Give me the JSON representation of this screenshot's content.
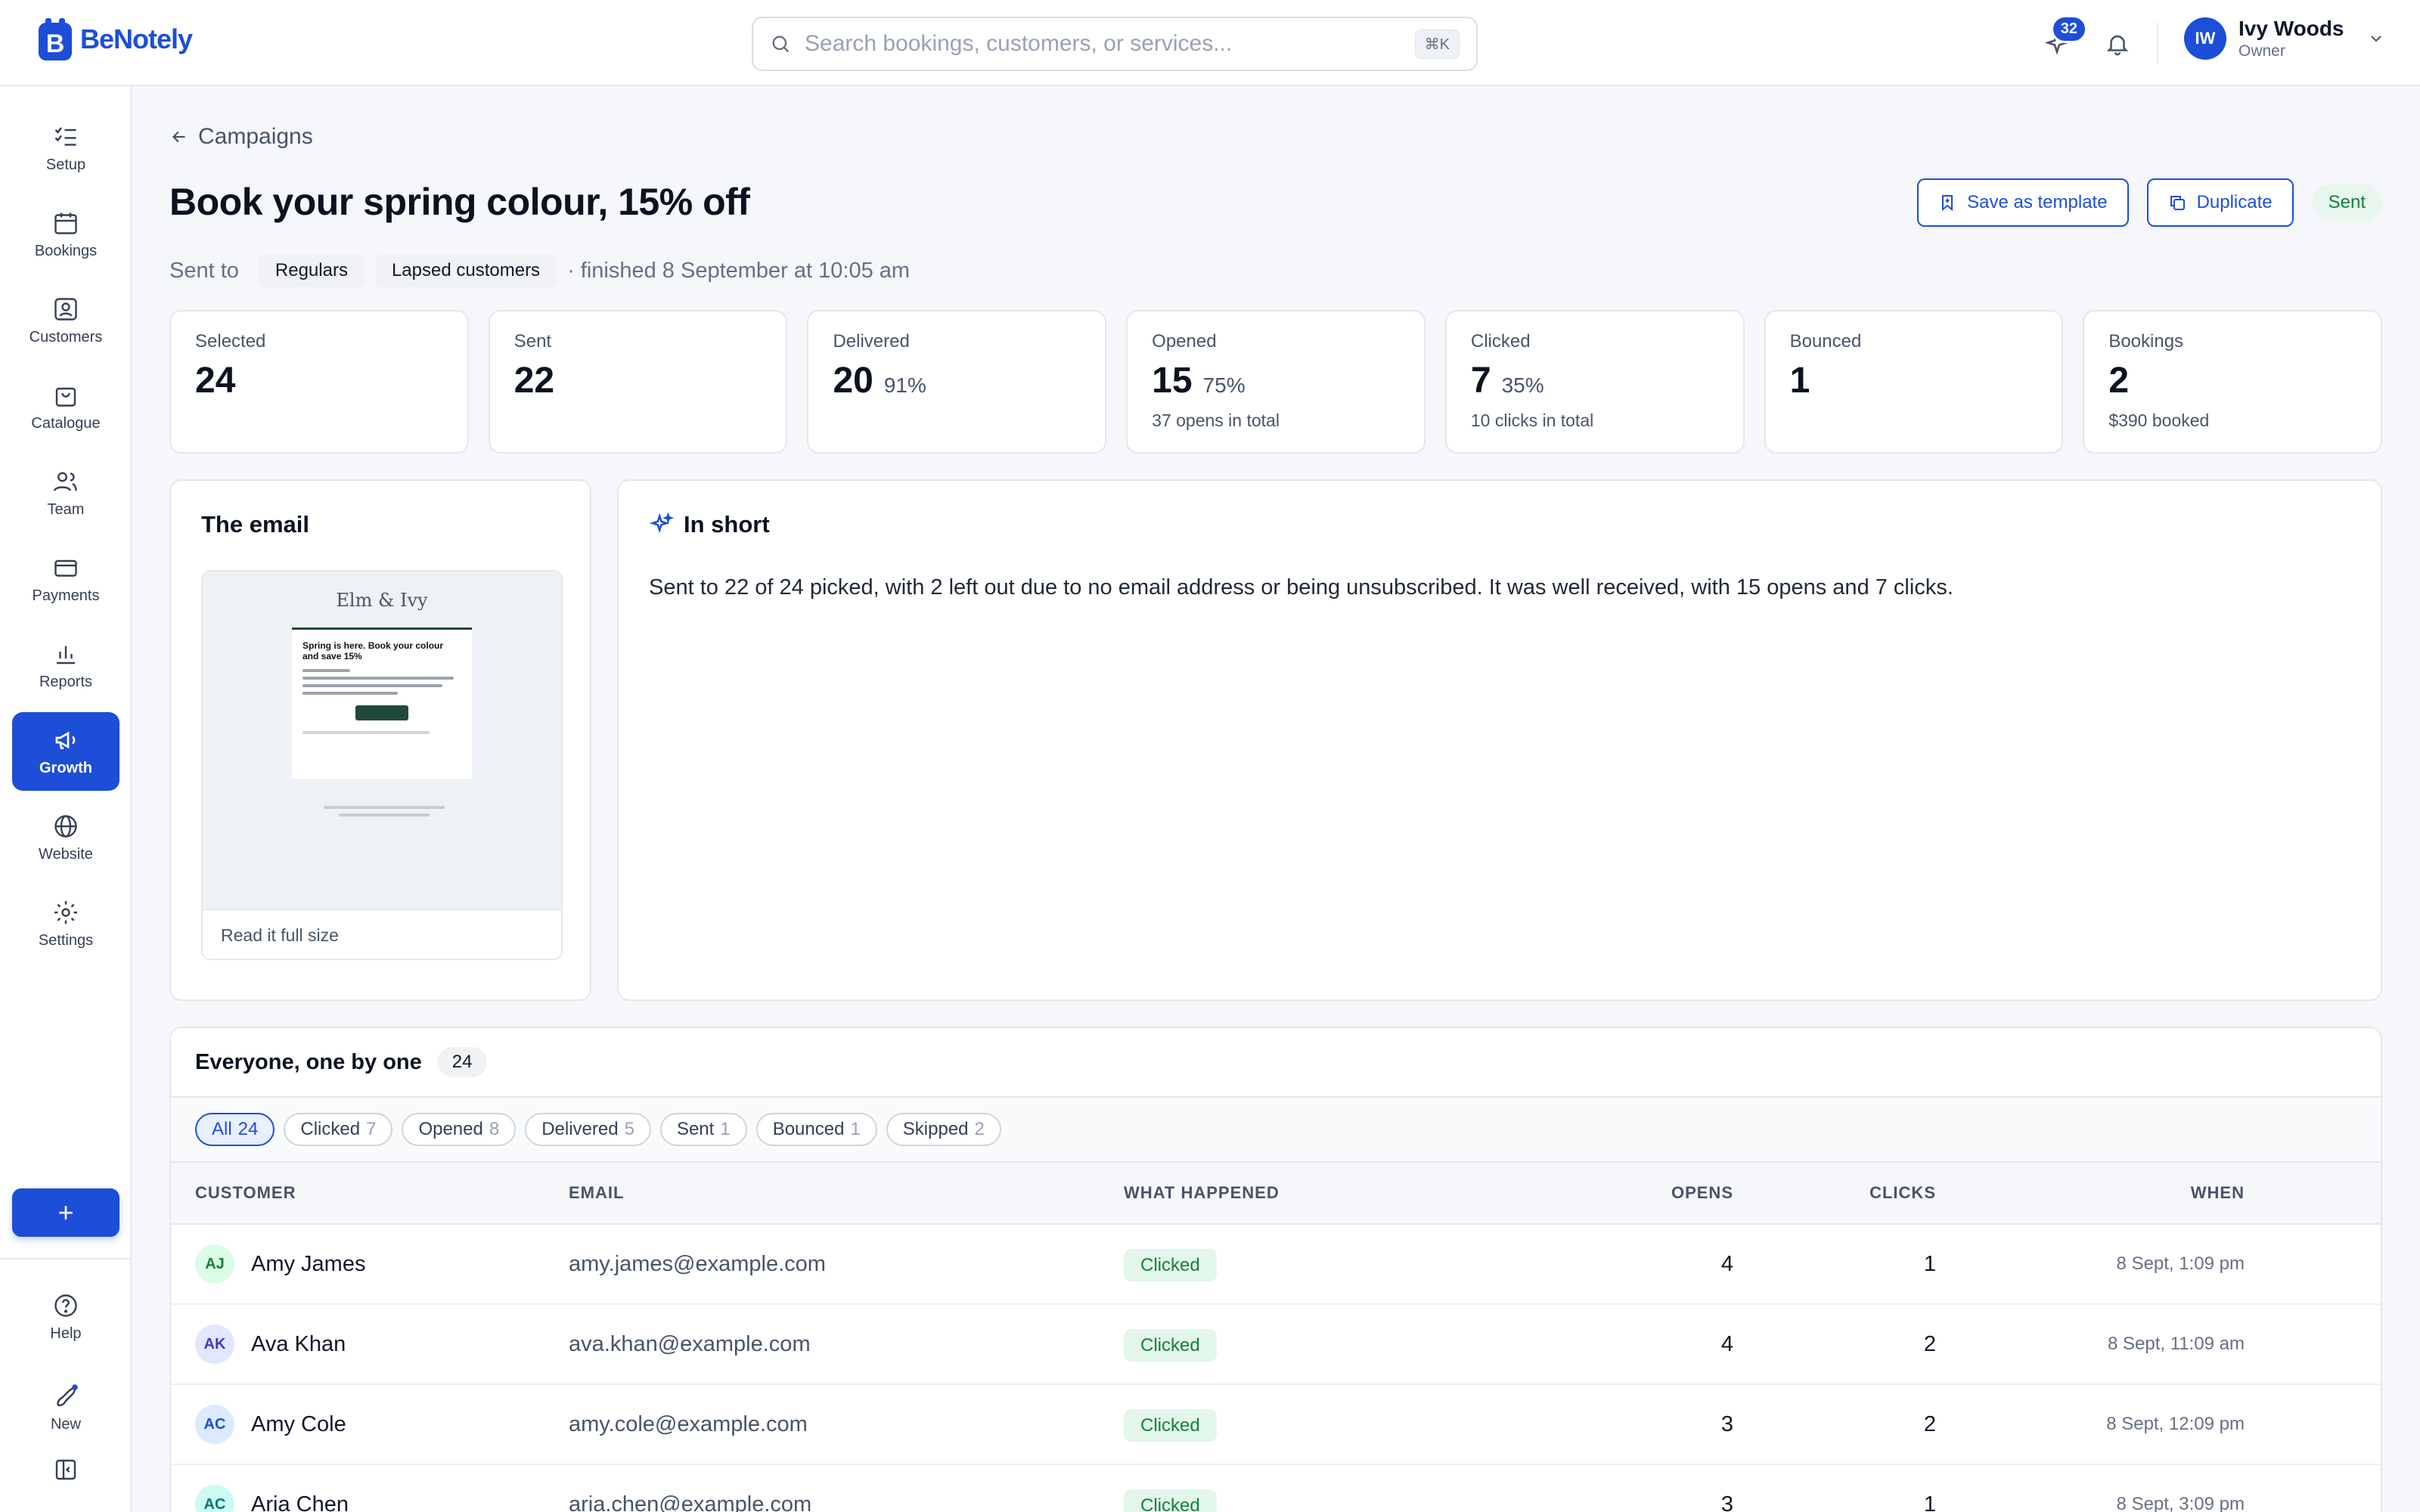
{
  "app": {
    "name": "BeNotely",
    "brand_color": "#1d4ed8"
  },
  "search": {
    "placeholder": "Search bookings, customers, or services...",
    "shortcut": "⌘K"
  },
  "header": {
    "notifications_count": "32"
  },
  "user": {
    "initials": "IW",
    "name": "Ivy Woods",
    "role": "Owner"
  },
  "sidebar": {
    "items": [
      {
        "label": "Setup",
        "icon": "checklist-icon"
      },
      {
        "label": "Bookings",
        "icon": "calendar-icon"
      },
      {
        "label": "Customers",
        "icon": "contact-icon"
      },
      {
        "label": "Catalogue",
        "icon": "bag-icon"
      },
      {
        "label": "Team",
        "icon": "people-icon"
      },
      {
        "label": "Payments",
        "icon": "card-icon"
      },
      {
        "label": "Reports",
        "icon": "chart-icon"
      },
      {
        "label": "Growth",
        "icon": "megaphone-icon",
        "active": true
      },
      {
        "label": "Website",
        "icon": "globe-icon"
      },
      {
        "label": "Settings",
        "icon": "gear-icon"
      }
    ],
    "new_button": "+",
    "help": "Help",
    "new": "New"
  },
  "page": {
    "back": "Campaigns",
    "title": "Book your spring colour, 15% off",
    "save_template": "Save as template",
    "duplicate": "Duplicate",
    "status": "Sent",
    "sent_to_label": "Sent to",
    "audiences": [
      "Regulars",
      "Lapsed customers"
    ],
    "finished": "· finished 8 September at 10:05 am"
  },
  "stats": [
    {
      "label": "Selected",
      "value": "24",
      "pct": "",
      "sub": ""
    },
    {
      "label": "Sent",
      "value": "22",
      "pct": "",
      "sub": ""
    },
    {
      "label": "Delivered",
      "value": "20",
      "pct": "91%",
      "sub": ""
    },
    {
      "label": "Opened",
      "value": "15",
      "pct": "75%",
      "sub": "37 opens in total"
    },
    {
      "label": "Clicked",
      "value": "7",
      "pct": "35%",
      "sub": "10 clicks in total"
    },
    {
      "label": "Bounced",
      "value": "1",
      "pct": "",
      "sub": ""
    },
    {
      "label": "Bookings",
      "value": "2",
      "pct": "",
      "sub": "$390 booked"
    }
  ],
  "email_card": {
    "title": "The email",
    "preview_brand": "Elm & Ivy",
    "preview_heading": "Spring is here. Book your colour and save 15%",
    "read_full": "Read it full size"
  },
  "summary": {
    "title": "In short",
    "text": "Sent to 22 of 24 picked, with 2 left out due to no email address or being unsubscribed. It was well received, with 15 opens and 7 clicks."
  },
  "table": {
    "title": "Everyone, one by one",
    "count": "24",
    "filters": [
      {
        "label": "All",
        "n": "24",
        "active": true
      },
      {
        "label": "Clicked",
        "n": "7"
      },
      {
        "label": "Opened",
        "n": "8"
      },
      {
        "label": "Delivered",
        "n": "5"
      },
      {
        "label": "Sent",
        "n": "1"
      },
      {
        "label": "Bounced",
        "n": "1"
      },
      {
        "label": "Skipped",
        "n": "2"
      }
    ],
    "columns": {
      "customer": "CUSTOMER",
      "email": "EMAIL",
      "what": "WHAT HAPPENED",
      "opens": "OPENS",
      "clicks": "CLICKS",
      "when": "WHEN"
    },
    "rows": [
      {
        "initials": "AJ",
        "name": "Amy James",
        "email": "amy.james@example.com",
        "status": "Clicked",
        "opens": "4",
        "clicks": "1",
        "when": "8 Sept, 1:09 pm",
        "av_bg": "#dcfce7",
        "av_fg": "#15803d"
      },
      {
        "initials": "AK",
        "name": "Ava Khan",
        "email": "ava.khan@example.com",
        "status": "Clicked",
        "opens": "4",
        "clicks": "2",
        "when": "8 Sept, 11:09 am",
        "av_bg": "#e0e7ff",
        "av_fg": "#4338ca"
      },
      {
        "initials": "AC",
        "name": "Amy Cole",
        "email": "amy.cole@example.com",
        "status": "Clicked",
        "opens": "3",
        "clicks": "2",
        "when": "8 Sept, 12:09 pm",
        "av_bg": "#dbeafe",
        "av_fg": "#1d4ed8"
      },
      {
        "initials": "AC",
        "name": "Aria Chen",
        "email": "aria.chen@example.com",
        "status": "Clicked",
        "opens": "3",
        "clicks": "1",
        "when": "8 Sept, 3:09 pm",
        "av_bg": "#ccfbf1",
        "av_fg": "#0f766e"
      }
    ]
  }
}
